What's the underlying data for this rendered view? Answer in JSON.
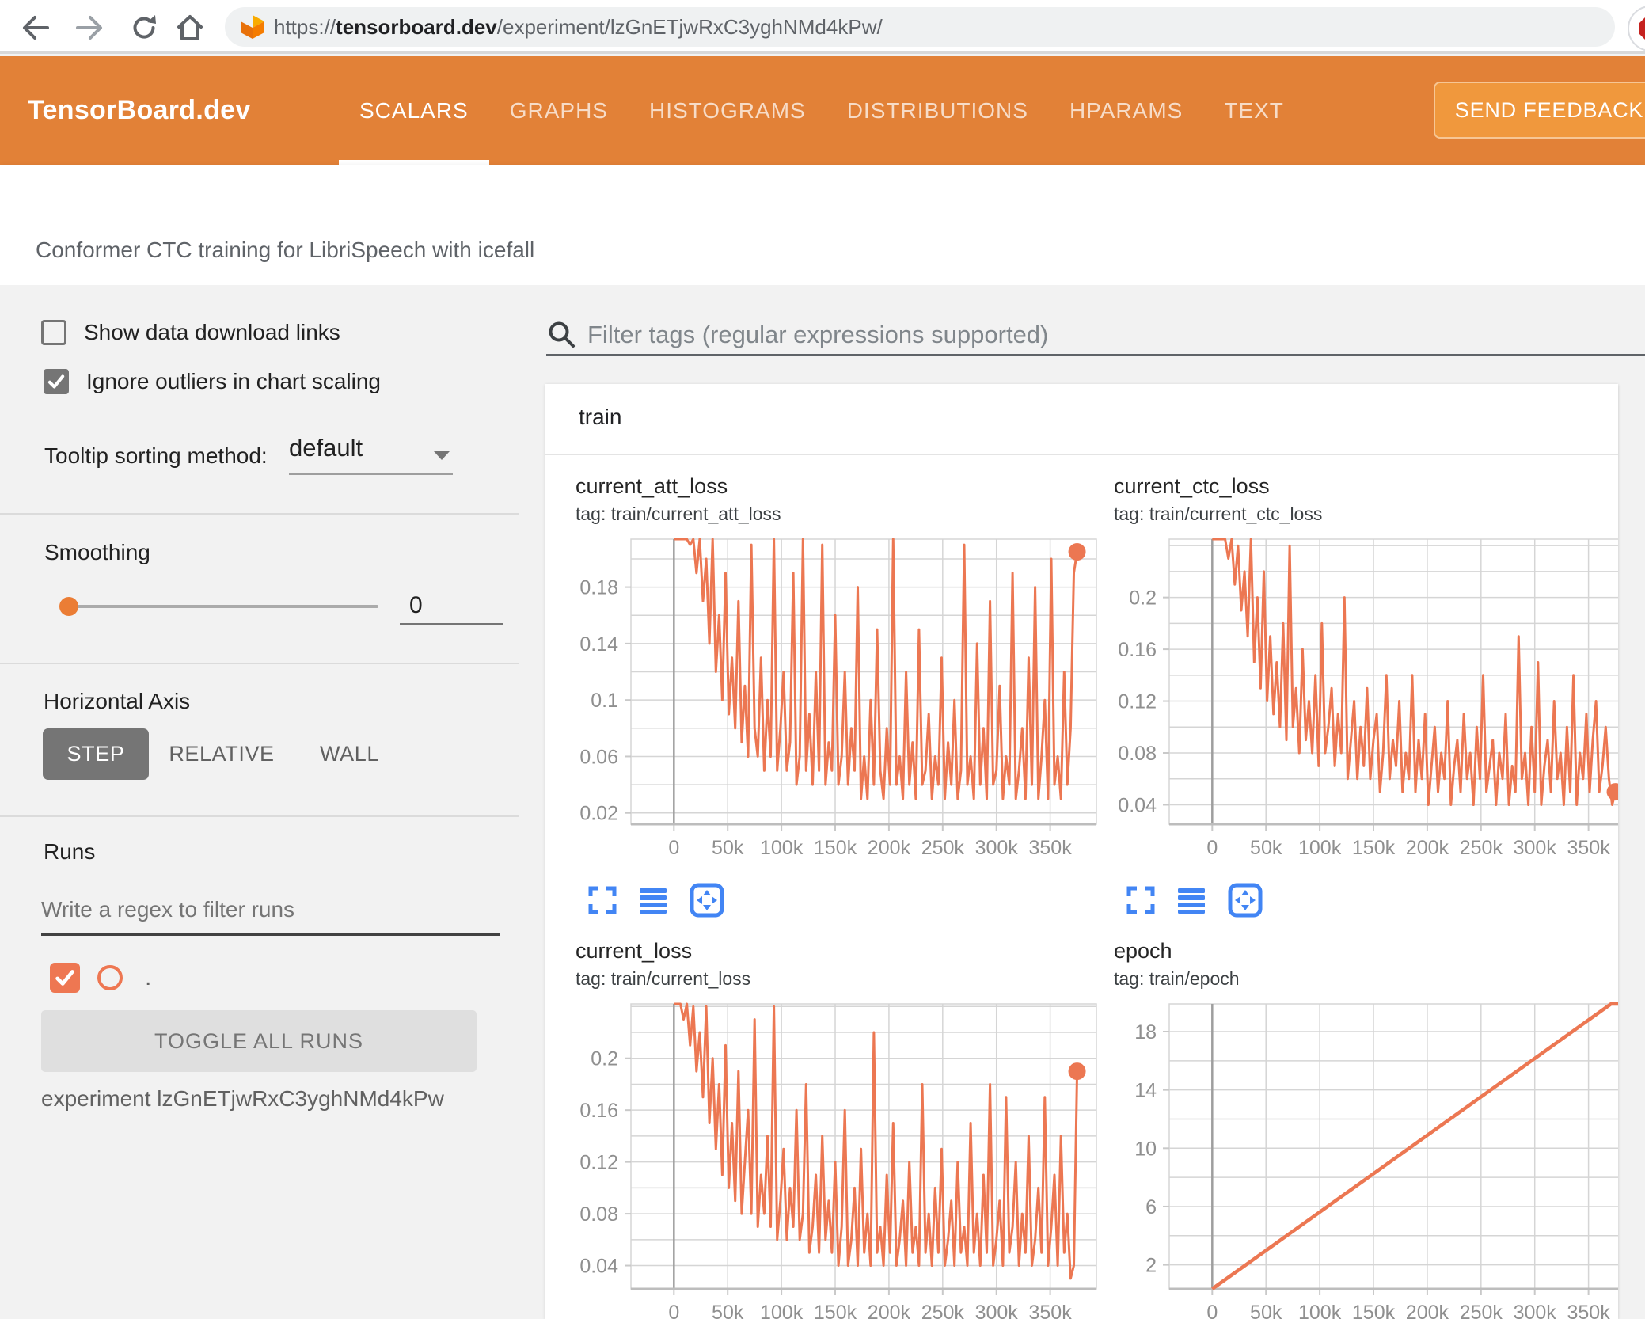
{
  "browser": {
    "url_scheme": "https://",
    "url_domain": "tensorboard.dev",
    "url_path": "/experiment/lzGnETjwRxC3yghNMd4kPw/"
  },
  "header": {
    "logo": "TensorBoard.dev",
    "tabs": [
      {
        "label": "SCALARS",
        "active": true
      },
      {
        "label": "GRAPHS",
        "active": false
      },
      {
        "label": "HISTOGRAMS",
        "active": false
      },
      {
        "label": "DISTRIBUTIONS",
        "active": false
      },
      {
        "label": "HPARAMS",
        "active": false
      },
      {
        "label": "TEXT",
        "active": false
      }
    ],
    "feedback_label": "SEND FEEDBACK"
  },
  "experiment_bar": {
    "title": "Conformer CTC training for LibriSpeech with icefall"
  },
  "sidebar": {
    "show_links": {
      "label": "Show data download links",
      "checked": false
    },
    "ignore_outliers": {
      "label": "Ignore outliers in chart scaling",
      "checked": true
    },
    "tooltip_sorting": {
      "label": "Tooltip sorting method:",
      "value": "default"
    },
    "smoothing": {
      "label": "Smoothing",
      "value": "0"
    },
    "horizontal_axis": {
      "label": "Horizontal Axis",
      "options": [
        "STEP",
        "RELATIVE",
        "WALL"
      ],
      "selected": "STEP"
    },
    "runs": {
      "label": "Runs",
      "filter_placeholder": "Write a regex to filter runs",
      "run_name": ".",
      "run_checked": true,
      "toggle_button": "TOGGLE ALL RUNS",
      "experiment_note": "experiment lzGnETjwRxC3yghNMd4kPw"
    }
  },
  "main": {
    "filter_placeholder": "Filter tags (regular expressions supported)",
    "section": "train"
  },
  "colors": {
    "header_orange": "#E28137",
    "feedback_button": "#F0983D",
    "run_line": "#EC7752",
    "slider_thumb": "#EB7D35",
    "toolbar_blue": "#4285F4",
    "grid": "#D5D5D5",
    "tick_text": "#8F8F8F"
  },
  "chart_data": [
    {
      "type": "line",
      "title": "current_att_loss",
      "tag": "tag: train/current_att_loss",
      "xlabel": "step",
      "ylabel": "loss",
      "xlim": [
        -40000,
        393000
      ],
      "ylim": [
        0.012,
        0.214
      ],
      "ygrid_step": 0.02,
      "ytick_vals": [
        0.02,
        0.06,
        0.1,
        0.14,
        0.18
      ],
      "ytick_labels": [
        "0.02",
        "0.06",
        "0.1",
        "0.14",
        "0.18"
      ],
      "xtick_vals": [
        0,
        50000,
        100000,
        150000,
        200000,
        250000,
        300000,
        350000
      ],
      "xtick_labels": [
        "0",
        "50k",
        "100k",
        "150k",
        "200k",
        "250k",
        "300k",
        "350k"
      ],
      "end_marker": true,
      "line_width": 3,
      "series": {
        "x0": 0,
        "dx": 3000,
        "values": [
          0.26,
          0.24,
          0.27,
          0.22,
          0.25,
          0.21,
          0.23,
          0.19,
          0.24,
          0.17,
          0.2,
          0.14,
          0.22,
          0.12,
          0.16,
          0.1,
          0.19,
          0.09,
          0.13,
          0.08,
          0.17,
          0.07,
          0.11,
          0.06,
          0.21,
          0.08,
          0.06,
          0.13,
          0.05,
          0.1,
          0.06,
          0.22,
          0.05,
          0.08,
          0.12,
          0.05,
          0.07,
          0.19,
          0.04,
          0.06,
          0.23,
          0.05,
          0.09,
          0.04,
          0.12,
          0.05,
          0.21,
          0.04,
          0.07,
          0.05,
          0.16,
          0.04,
          0.06,
          0.12,
          0.04,
          0.08,
          0.05,
          0.18,
          0.03,
          0.06,
          0.03,
          0.1,
          0.04,
          0.15,
          0.05,
          0.03,
          0.08,
          0.04,
          0.22,
          0.04,
          0.06,
          0.03,
          0.12,
          0.04,
          0.07,
          0.03,
          0.15,
          0.04,
          0.05,
          0.09,
          0.03,
          0.06,
          0.04,
          0.13,
          0.03,
          0.07,
          0.04,
          0.1,
          0.03,
          0.05,
          0.21,
          0.04,
          0.06,
          0.03,
          0.14,
          0.04,
          0.08,
          0.03,
          0.17,
          0.04,
          0.05,
          0.11,
          0.03,
          0.06,
          0.04,
          0.19,
          0.03,
          0.05,
          0.08,
          0.03,
          0.13,
          0.04,
          0.18,
          0.03,
          0.06,
          0.1,
          0.03,
          0.2,
          0.04,
          0.06,
          0.03,
          0.12,
          0.04,
          0.08,
          0.19,
          0.205
        ]
      }
    },
    {
      "type": "line",
      "title": "current_ctc_loss",
      "tag": "tag: train/current_ctc_loss",
      "xlabel": "step",
      "ylabel": "loss",
      "xlim": [
        -40000,
        393000
      ],
      "ylim": [
        0.025,
        0.245
      ],
      "ygrid_step": 0.02,
      "ytick_vals": [
        0.04,
        0.08,
        0.12,
        0.16,
        0.2
      ],
      "ytick_labels": [
        "0.04",
        "0.08",
        "0.12",
        "0.16",
        "0.2"
      ],
      "xtick_vals": [
        0,
        50000,
        100000,
        150000,
        200000,
        250000,
        300000,
        350000
      ],
      "xtick_labels": [
        "0",
        "50k",
        "100k",
        "150k",
        "200k",
        "250k",
        "300k",
        "350k"
      ],
      "end_marker": true,
      "line_width": 3,
      "series": {
        "x0": 0,
        "dx": 3000,
        "values": [
          0.3,
          0.27,
          0.29,
          0.25,
          0.28,
          0.23,
          0.26,
          0.21,
          0.24,
          0.19,
          0.22,
          0.17,
          0.25,
          0.15,
          0.2,
          0.13,
          0.22,
          0.12,
          0.17,
          0.11,
          0.15,
          0.1,
          0.18,
          0.09,
          0.24,
          0.1,
          0.13,
          0.08,
          0.16,
          0.09,
          0.12,
          0.08,
          0.14,
          0.07,
          0.18,
          0.08,
          0.1,
          0.13,
          0.07,
          0.11,
          0.08,
          0.2,
          0.06,
          0.09,
          0.12,
          0.06,
          0.1,
          0.07,
          0.13,
          0.06,
          0.09,
          0.11,
          0.05,
          0.08,
          0.14,
          0.06,
          0.09,
          0.07,
          0.12,
          0.05,
          0.08,
          0.06,
          0.14,
          0.05,
          0.09,
          0.06,
          0.11,
          0.04,
          0.07,
          0.1,
          0.05,
          0.08,
          0.06,
          0.12,
          0.04,
          0.07,
          0.09,
          0.05,
          0.11,
          0.06,
          0.08,
          0.04,
          0.1,
          0.06,
          0.14,
          0.05,
          0.07,
          0.09,
          0.04,
          0.08,
          0.06,
          0.11,
          0.04,
          0.07,
          0.05,
          0.17,
          0.06,
          0.08,
          0.04,
          0.1,
          0.05,
          0.15,
          0.04,
          0.07,
          0.09,
          0.05,
          0.12,
          0.06,
          0.08,
          0.04,
          0.1,
          0.05,
          0.14,
          0.04,
          0.08,
          0.06,
          0.11,
          0.05,
          0.09,
          0.12,
          0.05,
          0.07,
          0.1,
          0.06,
          0.04,
          0.05
        ]
      }
    },
    {
      "type": "line",
      "title": "current_loss",
      "tag": "tag: train/current_loss",
      "xlabel": "step",
      "ylabel": "loss",
      "xlim": [
        -40000,
        393000
      ],
      "ylim": [
        0.022,
        0.242
      ],
      "ygrid_step": 0.02,
      "ytick_vals": [
        0.04,
        0.08,
        0.12,
        0.16,
        0.2
      ],
      "ytick_labels": [
        "0.04",
        "0.08",
        "0.12",
        "0.16",
        "0.2"
      ],
      "xtick_vals": [
        0,
        50000,
        100000,
        150000,
        200000,
        250000,
        300000,
        350000
      ],
      "xtick_labels": [
        "0",
        "50k",
        "100k",
        "150k",
        "200k",
        "250k",
        "300k",
        "350k"
      ],
      "end_marker": true,
      "line_width": 3,
      "series": {
        "x0": 0,
        "dx": 3000,
        "values": [
          0.28,
          0.25,
          0.27,
          0.23,
          0.26,
          0.21,
          0.24,
          0.19,
          0.22,
          0.17,
          0.24,
          0.15,
          0.2,
          0.13,
          0.18,
          0.11,
          0.21,
          0.1,
          0.15,
          0.09,
          0.19,
          0.08,
          0.12,
          0.16,
          0.08,
          0.23,
          0.07,
          0.11,
          0.08,
          0.14,
          0.07,
          0.24,
          0.06,
          0.09,
          0.13,
          0.06,
          0.1,
          0.07,
          0.16,
          0.06,
          0.08,
          0.18,
          0.05,
          0.07,
          0.11,
          0.05,
          0.14,
          0.06,
          0.09,
          0.05,
          0.12,
          0.04,
          0.07,
          0.16,
          0.04,
          0.06,
          0.1,
          0.04,
          0.13,
          0.05,
          0.08,
          0.04,
          0.22,
          0.05,
          0.07,
          0.04,
          0.11,
          0.05,
          0.15,
          0.04,
          0.06,
          0.09,
          0.04,
          0.12,
          0.05,
          0.07,
          0.04,
          0.18,
          0.05,
          0.08,
          0.04,
          0.1,
          0.05,
          0.13,
          0.04,
          0.06,
          0.09,
          0.04,
          0.12,
          0.05,
          0.07,
          0.04,
          0.15,
          0.05,
          0.08,
          0.04,
          0.11,
          0.05,
          0.18,
          0.04,
          0.06,
          0.09,
          0.04,
          0.17,
          0.05,
          0.07,
          0.12,
          0.04,
          0.08,
          0.05,
          0.14,
          0.04,
          0.06,
          0.1,
          0.05,
          0.17,
          0.04,
          0.07,
          0.11,
          0.04,
          0.14,
          0.05,
          0.08,
          0.03,
          0.04,
          0.19
        ]
      }
    },
    {
      "type": "line",
      "title": "epoch",
      "tag": "tag: train/epoch",
      "xlabel": "step",
      "ylabel": "epoch",
      "xlim": [
        -40000,
        393000
      ],
      "ylim": [
        0.35,
        19.9
      ],
      "ygrid_step": 2,
      "ytick_vals": [
        2,
        6,
        10,
        14,
        18
      ],
      "ytick_labels": [
        "2",
        "6",
        "10",
        "14",
        "18"
      ],
      "xtick_vals": [
        0,
        50000,
        100000,
        150000,
        200000,
        250000,
        300000,
        350000
      ],
      "xtick_labels": [
        "0",
        "50k",
        "100k",
        "150k",
        "200k",
        "250k",
        "300k",
        "350k"
      ],
      "end_marker": false,
      "line_width": 4.5,
      "series": {
        "points": [
          [
            0,
            0.35
          ],
          [
            371000,
            19.9
          ],
          [
            390000,
            19.9
          ]
        ]
      }
    }
  ]
}
